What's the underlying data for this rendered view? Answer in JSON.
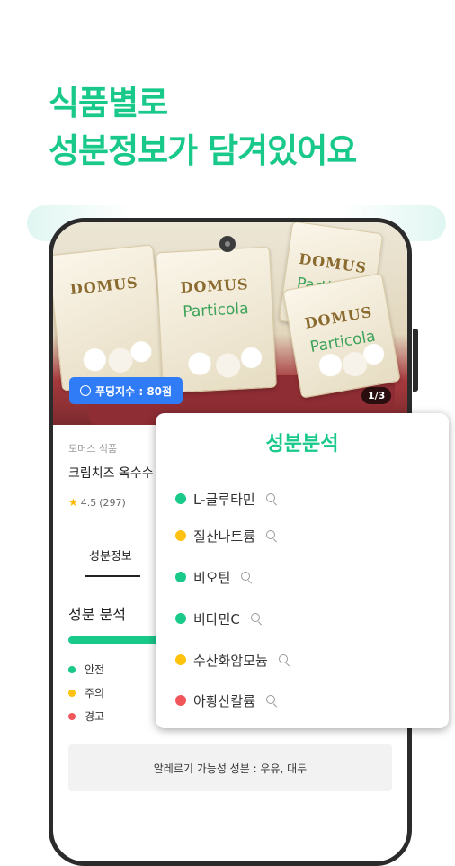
{
  "headline": {
    "line1": "식품별로",
    "line2": "성분정보가 담겨있어요"
  },
  "colors": {
    "accent": "#19c98a",
    "badge_blue": "#2f7cf6",
    "safe": "#19c98a",
    "caution": "#ffc20e",
    "warning": "#f0555a"
  },
  "product": {
    "image_bags": [
      {
        "brand": "DOMUS",
        "name": ""
      },
      {
        "brand": "DOMUS",
        "name": "Particola"
      },
      {
        "brand": "DOMUS",
        "name": "Particola Tre"
      },
      {
        "brand": "DOMUS",
        "name": "Particola"
      }
    ],
    "badge": "푸딩지수 : 80점",
    "image_counter": "1/3",
    "brand": "도머스 식품",
    "name": "크림치즈 옥수수",
    "rating": "4.5",
    "review_count": "(297)"
  },
  "tabs": [
    {
      "label": "성분정보",
      "active": true
    }
  ],
  "analysis": {
    "title": "성분 분석",
    "legend": [
      {
        "label": "안전",
        "status": "safe"
      },
      {
        "label": "주의",
        "status": "caution"
      },
      {
        "label": "경고",
        "status": "warning"
      }
    ]
  },
  "allergy_text": "알레르기 가능성 성분 : 우유, 대두",
  "popup": {
    "title": "성분분석",
    "ingredients": [
      {
        "name": "L-글루타민",
        "status": "safe",
        "icon": "search-icon"
      },
      {
        "name": "질산나트륨",
        "status": "caution",
        "icon": "search-icon"
      },
      {
        "name": "비오틴",
        "status": "safe",
        "icon": "search-icon"
      },
      {
        "name": "비타민C",
        "status": "safe",
        "icon": "search-icon"
      },
      {
        "name": "수산화암모늄",
        "status": "caution",
        "icon": "search-icon"
      },
      {
        "name": "아황산칼륨",
        "status": "warning",
        "icon": "search-icon"
      }
    ]
  }
}
